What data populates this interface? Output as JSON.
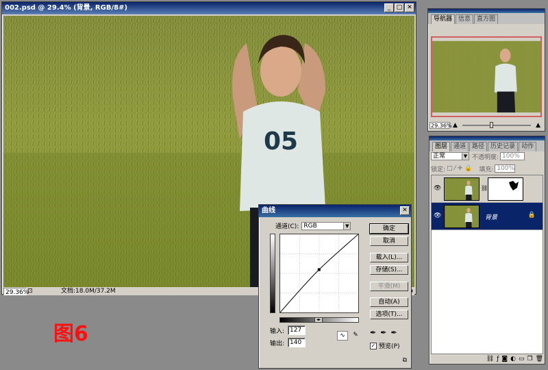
{
  "document": {
    "title": "002.psd @ 29.4% (背景, RGB/8#)",
    "zoom": "29.36%",
    "doc_info": "文档:18.0M/37.2M"
  },
  "navigator": {
    "tabs": [
      "导航器",
      "信息",
      "直方图"
    ],
    "zoom": "29.36%"
  },
  "layers": {
    "tabs": [
      "图层",
      "通道",
      "路径",
      "历史记录",
      "动作"
    ],
    "blend_mode": "正常",
    "opacity_label": "不透明度:",
    "opacity": "100%",
    "lock_label": "锁定:",
    "fill_label": "填充:",
    "fill": "100%",
    "items": [
      {
        "name": "",
        "selected": false
      },
      {
        "name": "背景",
        "selected": true
      }
    ]
  },
  "curves": {
    "title": "曲线",
    "channel_label": "通道(C):",
    "channel": "RGB",
    "input_label": "输入:",
    "input": "127",
    "output_label": "输出:",
    "output": "140",
    "buttons": {
      "ok": "确定",
      "cancel": "取消",
      "load": "载入(L)...",
      "save": "存储(S)...",
      "smooth": "平滑(M)",
      "auto": "自动(A)",
      "options": "选项(T)..."
    },
    "preview_label": "预览(P)",
    "preview_checked": true
  },
  "figure_label": "图6"
}
